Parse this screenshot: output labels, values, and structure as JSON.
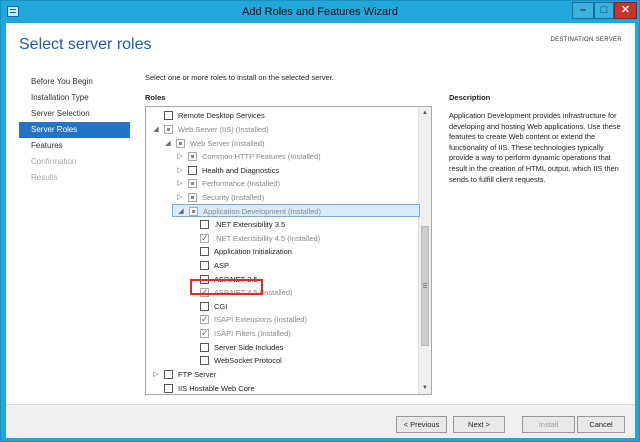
{
  "window": {
    "title": "Add Roles and Features Wizard",
    "minimize_label": "–",
    "maximize_label": "□",
    "close_label": "✕"
  },
  "page": {
    "title": "Select server roles",
    "destination_label": "DESTINATION SERVER"
  },
  "nav": {
    "items": [
      {
        "label": "Before You Begin",
        "state": "normal"
      },
      {
        "label": "Installation Type",
        "state": "normal"
      },
      {
        "label": "Server Selection",
        "state": "normal"
      },
      {
        "label": "Server Roles",
        "state": "selected"
      },
      {
        "label": "Features",
        "state": "normal"
      },
      {
        "label": "Confirmation",
        "state": "disabled"
      },
      {
        "label": "Results",
        "state": "disabled"
      }
    ]
  },
  "main": {
    "intro": "Select one or more roles to install on the selected server.",
    "roles_label": "Roles",
    "roles": [
      {
        "label": "Remote Desktop Services",
        "check": "unchecked",
        "expander": "",
        "gray": false
      },
      {
        "label": "Web Server (IIS) (Installed)",
        "check": "partial",
        "expander": "◢",
        "gray": true
      },
      {
        "label": "Web Server (Installed)",
        "check": "partial",
        "expander": "◢",
        "gray": true
      },
      {
        "label": "Common HTTP Features (Installed)",
        "check": "partial",
        "expander": "▷",
        "gray": true
      },
      {
        "label": "Health and Diagnostics",
        "check": "unchecked",
        "expander": "▷",
        "gray": false
      },
      {
        "label": "Performance (Installed)",
        "check": "partial",
        "expander": "▷",
        "gray": true
      },
      {
        "label": "Security (Installed)",
        "check": "partial",
        "expander": "▷",
        "gray": true
      },
      {
        "label": "Application Development (Installed)",
        "check": "partial",
        "expander": "◢",
        "gray": true,
        "highlight": true
      },
      {
        "label": ".NET Extensibility 3.5",
        "check": "unchecked",
        "expander": "",
        "gray": false
      },
      {
        "label": ".NET Extensibility 4.5 (Installed)",
        "check": "checked",
        "expander": "",
        "gray": true
      },
      {
        "label": "Application Initialization",
        "check": "unchecked",
        "expander": "",
        "gray": false
      },
      {
        "label": "ASP",
        "check": "unchecked",
        "expander": "",
        "gray": false
      },
      {
        "label": "ASP.NET 3.5",
        "check": "unchecked",
        "expander": "",
        "gray": false
      },
      {
        "label": "ASP.NET 4.5 (Installed)",
        "check": "checked",
        "expander": "",
        "gray": true
      },
      {
        "label": "CGI",
        "check": "unchecked",
        "expander": "",
        "gray": false
      },
      {
        "label": "ISAPI Extensions (Installed)",
        "check": "checked",
        "expander": "",
        "gray": true
      },
      {
        "label": "ISAPI Filters (Installed)",
        "check": "checked",
        "expander": "",
        "gray": true
      },
      {
        "label": "Server Side Includes",
        "check": "unchecked",
        "expander": "",
        "gray": false
      },
      {
        "label": "WebSocket Protocol",
        "check": "unchecked",
        "expander": "",
        "gray": false
      },
      {
        "label": "FTP Server",
        "check": "unchecked",
        "expander": "▷",
        "gray": false
      },
      {
        "label": "IIS Hostable Web Core",
        "check": "unchecked",
        "expander": "",
        "gray": false
      }
    ]
  },
  "description": {
    "label": "Description",
    "text": "Application Development provides infrastructure for developing and hosting Web applications. Use these features to create Web content or extend the functionality of IIS. These technologies typically provide a way to perform dynamic operations that result in the creation of HTML output, which IIS then sends to fulfill client requests."
  },
  "footer": {
    "previous_label": "< Previous",
    "next_label": "Next >",
    "install_label": "Install",
    "cancel_label": "Cancel"
  },
  "colors": {
    "titlebar": "#21a7d9",
    "nav_selected": "#2473c8",
    "annotation_box": "#e6282d"
  }
}
